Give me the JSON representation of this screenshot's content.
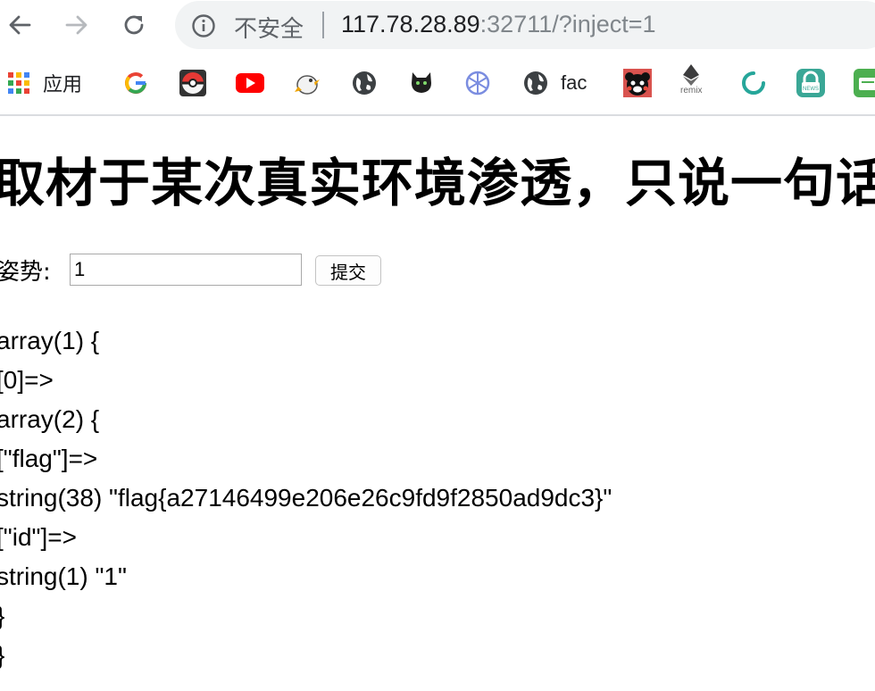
{
  "browser": {
    "security_label": "不安全",
    "url_host": "117.78.28.89",
    "url_rest": ":32711/?inject=1",
    "bookmarks": [
      {
        "icon": "apps-grid-icon",
        "label": "应用"
      },
      {
        "icon": "google-icon",
        "label": ""
      },
      {
        "icon": "pokeball-icon",
        "label": ""
      },
      {
        "icon": "youtube-icon",
        "label": ""
      },
      {
        "icon": "bird-icon",
        "label": ""
      },
      {
        "icon": "globe-icon",
        "label": ""
      },
      {
        "icon": "cat-icon",
        "label": ""
      },
      {
        "icon": "compass-icon",
        "label": ""
      },
      {
        "icon": "globe-icon",
        "label": "fac"
      },
      {
        "icon": "bear-icon",
        "label": ""
      },
      {
        "icon": "ethereum-icon",
        "label": "remix"
      },
      {
        "icon": "ring-icon",
        "label": ""
      },
      {
        "icon": "news-icon",
        "label": ""
      },
      {
        "icon": "green-tab-icon",
        "label": ""
      }
    ]
  },
  "page": {
    "title": "取材于某次真实环境渗透，只说一句话：",
    "form_label": "姿势:",
    "input_value": "1",
    "submit_label": "提交",
    "dump": [
      "array(1) {",
      "  [0]=>",
      "  array(2) {",
      "    [\"flag\"]=>",
      "    string(38) \"flag{a27146499e206e26c9fd9f2850ad9dc3}\"",
      "    [\"id\"]=>",
      "    string(1) \"1\"",
      "  }",
      "}"
    ]
  },
  "colors": {
    "omnibox_bg": "#f1f3f4",
    "url_host": "#202124",
    "url_rest": "#80868b",
    "youtube_red": "#ff0000",
    "ring_teal": "#26a69a",
    "news_teal": "#3aa796",
    "green_tab": "#4caf50"
  }
}
